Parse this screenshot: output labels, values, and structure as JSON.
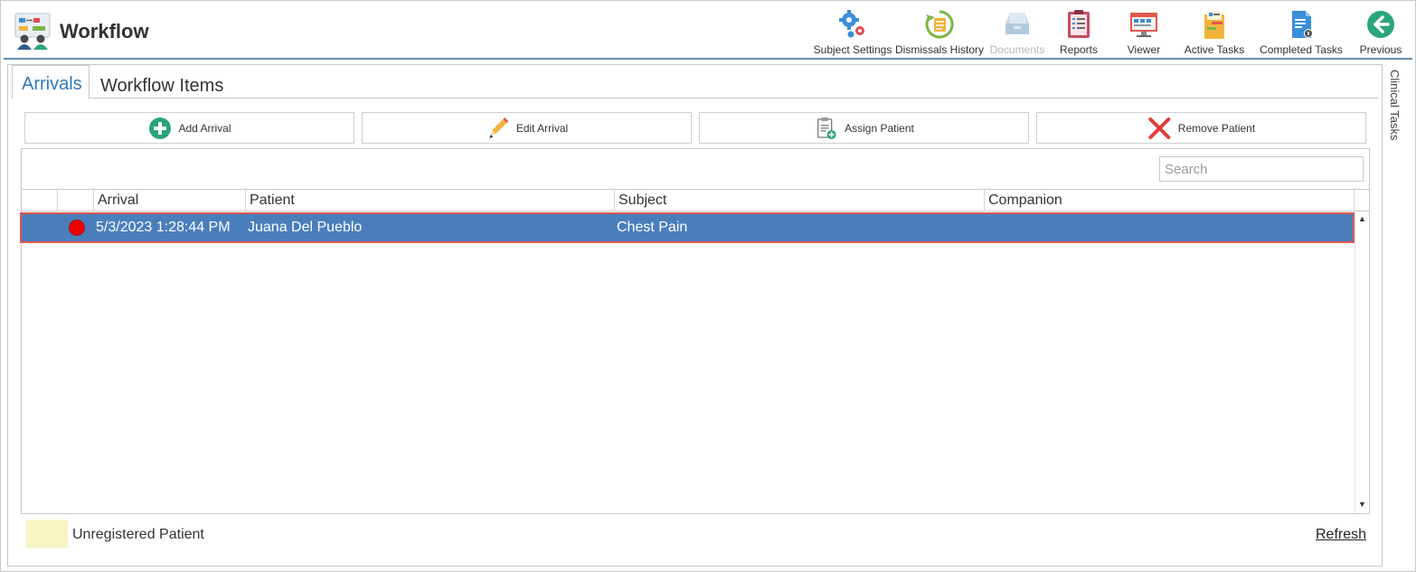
{
  "header": {
    "title": "Workflow",
    "toolbar": [
      {
        "label": "Subject Settings",
        "icon": "gears-icon",
        "disabled": false
      },
      {
        "label": "Dismissals History",
        "icon": "history-icon",
        "disabled": false
      },
      {
        "label": "Documents",
        "icon": "documents-icon",
        "disabled": true
      },
      {
        "label": "Reports",
        "icon": "reports-icon",
        "disabled": false
      },
      {
        "label": "Viewer",
        "icon": "viewer-icon",
        "disabled": false
      },
      {
        "label": "Active Tasks",
        "icon": "active-tasks-icon",
        "disabled": false
      },
      {
        "label": "Completed Tasks",
        "icon": "completed-tasks-icon",
        "disabled": false
      },
      {
        "label": "Previous",
        "icon": "back-arrow-icon",
        "disabled": false
      }
    ]
  },
  "tabs": {
    "arrivals": "Arrivals",
    "workflow_items": "Workflow Items",
    "active": "Arrivals"
  },
  "actions": {
    "add_arrival": "Add Arrival",
    "edit_arrival": "Edit Arrival",
    "assign_patient": "Assign Patient",
    "remove_patient": "Remove Patient"
  },
  "search": {
    "placeholder": "Search",
    "value": ""
  },
  "grid": {
    "columns": [
      "",
      "",
      "Arrival",
      "Patient",
      "Subject",
      "Companion"
    ],
    "rows": [
      {
        "status": "red",
        "arrival": "5/3/2023 1:28:44 PM",
        "patient": "Juana Del Pueblo",
        "subject": "Chest Pain",
        "companion": "",
        "selected": true
      }
    ]
  },
  "legend": {
    "label": "Unregistered Patient",
    "color": "#f6f3c4"
  },
  "refresh": "Refresh",
  "side_tab": "Clinical Tasks",
  "colors": {
    "selection": "#4a7ebb",
    "selection_outline": "#e0574f",
    "active_tab": "#2e78b8",
    "status_red": "#ee0000"
  }
}
